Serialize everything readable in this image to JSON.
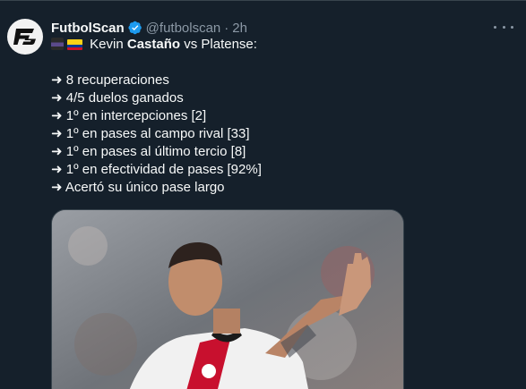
{
  "tweet": {
    "author_name": "FutbolScan",
    "handle": "@futbolscan",
    "separator": "·",
    "time": "2h",
    "intro": {
      "player_first": "Kevin",
      "player_last": "Castaño",
      "opponent": "vs Platense:"
    },
    "arrow": "➜",
    "stats": [
      "8 recuperaciones",
      "4/5 duelos ganados",
      "1º en intercepciones [2]",
      "1º en pases al campo rival [33]",
      "1º en pases al último tercio [8]",
      "1º en efectividad de pases [92%]",
      "Acertó su único pase largo"
    ]
  },
  "icons": {
    "avatar": "futbolscan-logo",
    "verified": "verified-badge-icon",
    "more": "more-options-icon",
    "flag1": "club-flag",
    "flag2": "colombia-flag"
  },
  "colors": {
    "background": "#15202b",
    "text": "#f7f9f9",
    "secondary_text": "#8b98a5",
    "verified": "#1d9bf0"
  }
}
